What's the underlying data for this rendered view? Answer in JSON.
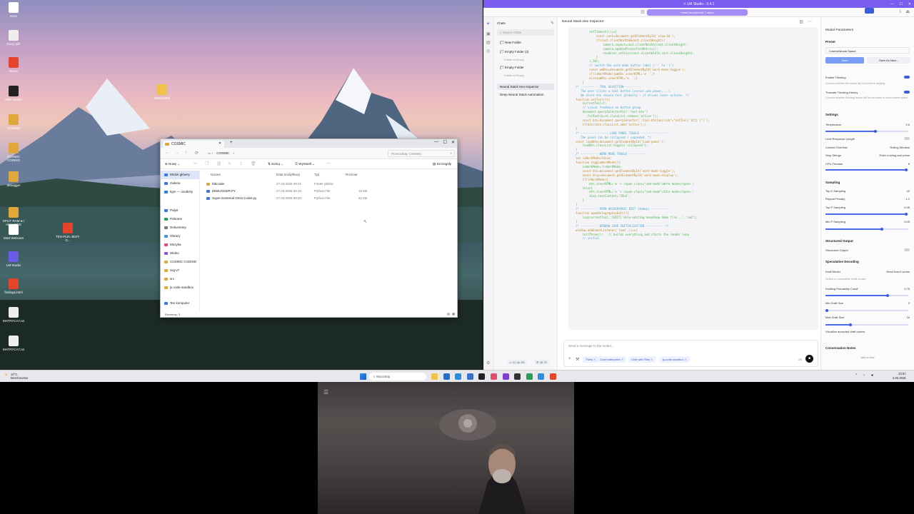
{
  "desktop": {
    "icons": [
      {
        "label": "Kosz",
        "color": "#ffffff"
      },
      {
        "label": "Nowy plik",
        "color": "#eeeeee"
      },
      {
        "label": "Brave",
        "color": "#e5432a"
      },
      {
        "label": "OBS Studio",
        "color": "#222222"
      },
      {
        "label": "COSMIC",
        "color": "#e0a83a"
      },
      {
        "label": "COSMIC CODING",
        "color": "#e0a83a"
      },
      {
        "label": "debugger",
        "color": "#e0a83a"
      },
      {
        "label": "SPLIT RAM & I AM A GOD",
        "color": "#e0a83a"
      },
      {
        "label": "Start Webcam",
        "color": "#ffffff"
      },
      {
        "label": "LM Studio",
        "color": "#6b5ce7"
      },
      {
        "label": "findings.html",
        "color": "#e5432a"
      },
      {
        "label": "MATRYCA7.txt",
        "color": "#eeeeee"
      },
      {
        "label": "MATRYCA7.txt",
        "color": "#eeeeee"
      }
    ],
    "loose_icons": [
      {
        "label": "DEBUGER",
        "color": "#f0c24a"
      },
      {
        "label": "TEN-PLIK-JEST-G...",
        "color": "#e5432a"
      }
    ]
  },
  "explorer": {
    "tab_title": "COSMIC",
    "breadcrumb": [
      "COSMIC"
    ],
    "search_placeholder": "Przeszukaj: COSMIC",
    "toolbar": {
      "new": "Nowy",
      "sort": "Sortuj",
      "view": "Wyświetl",
      "more": "···",
      "details": "Szczegóły"
    },
    "nav": [
      {
        "label": "Widok główny",
        "color": "#3b78e7"
      },
      {
        "label": "Galeria",
        "color": "#3b78e7"
      },
      {
        "label": "kgm — osobisty",
        "color": "#2b7bd8"
      },
      {
        "label": "Pulpit",
        "color": "#3b78e7"
      },
      {
        "label": "Pobrane",
        "color": "#2a9d5b"
      },
      {
        "label": "Dokumenty",
        "color": "#7a7a7a"
      },
      {
        "label": "Obrazy",
        "color": "#4a8fe0"
      },
      {
        "label": "Muzyka",
        "color": "#e24a6e"
      },
      {
        "label": "Wideo",
        "color": "#8a55d8"
      },
      {
        "label": "COSMIC CODING",
        "color": "#e0a83a"
      },
      {
        "label": "ssg-v7",
        "color": "#e0a83a"
      },
      {
        "label": "src",
        "color": "#e0a83a"
      },
      {
        "label": "js-code-sandbox",
        "color": "#e0a83a"
      },
      {
        "label": "Ten komputer",
        "color": "#3b78e7"
      }
    ],
    "columns": [
      "Nazwa",
      "Data modyfikacji",
      "Typ",
      "Rozmiar"
    ],
    "rows": [
      {
        "name": "htbcoder",
        "date": "27.03.2026 09:41",
        "type": "Folder plików",
        "size": "",
        "color": "#e0a83a"
      },
      {
        "name": "DEBUGGER.PY",
        "date": "27.03.2026 00:10",
        "type": "Python File",
        "size": "15 KB",
        "color": "#3b78e7"
      },
      {
        "name": "Super Extremal Omni Coder.py",
        "date": "27.03.2026 00:20",
        "type": "Python File",
        "size": "21 KB",
        "color": "#3b78e7"
      }
    ],
    "status": "Elementy: 3"
  },
  "lmstudio": {
    "title": "LM Studio - 0.4.1",
    "model_selector": "metal-llama/metal-7-nemo",
    "chats_label": "Chats",
    "search_chats": "Search chats",
    "new_folder": "New Folder",
    "folders": [
      {
        "name": "Empty Folder (2)",
        "empty": "Folder is Empty"
      },
      {
        "name": "Empty Folder",
        "empty": "Folder is Empty"
      }
    ],
    "chats": [
      "Neural Stack Hex Inspector",
      "Deep Neural Stack Automation"
    ],
    "active_chat": "Neural Stack Hex Inspector",
    "code_lines": [
      "        setTimeout(()=>{",
      "            const cont=document.getElementById('view-3d');",
      "            if(cont.clientWidth&&cont.clientHeight){",
      "                camera.aspect=cont.clientWidth/cont.clientHeight;",
      "                camera.updateProjectionMatrix();",
      "                renderer.setSize(cont.clientWidth,cont.clientHeight);",
      "            }",
      "        },50);",
      "",
      "        // switch the work-mode button label ('-' to '|')",
      "        const wmBtn=document.getElementById('work-mode-toggle');",
      "        if(isWorkMode){wmBtn.innerHTML='⊗  ';}",
      "        else{wmBtn.innerHTML='⊕  ';}",
      "    }",
      "",
      "/* ---------- TOOL SELECTION ---------",
      "   The user clicks a tool button (cursor,pan,power,...).",
      "   We store the chosen tool globally – it drives later actions. */",
      "function setTool(t){",
      "    currentTool=t;",
      "",
      "    // visual feedback on button group",
      "    document.querySelectorAll('.tool-btn')",
      "      .forEach(b=>b.classList.remove('active'));",
      "    const btn=document.querySelector(`.tool-btn[onclick*=\"setTool('${t}')\"]`);",
      "    if(btn){btn.classList.add('active');}",
      "}",
      "",
      "/* ---------------- LOAD PANEL TOGGLE ----------------",
      "   The panel can be collapsed / expanded. */",
      "const loadBtn=document.getElementById('load-panel');",
      "    loadBtn.classList.toggle('collapsed');",
      "}",
      "",
      "/* ---------- WORK-MODE TOGGLE -----------",
      "let isWorkMode=false;",
      "function toggleWorkMode(){",
      "    isWorkMode=!isWorkMode;",
      "",
      "    const btn=document.getElementById('work-mode-toggle');",
      "    const disp=document.getElementById('work-mode-display');",
      "",
      "    if(isWorkMode){",
      "        btn.innerHTML='⊗ '+`<span class=\"cmd-mode\">Work mode</span>`;",
      "    }else{",
      "        btn.innerHTML='⊕ '+`<span class=\"cmd-mode\">Idle mode</span>`;",
      "        disp.textContent='IDLE';",
      "    }",
      "}",
      "",
      "/* ---------- OPEN HOLOGRAPHIC EDIT (dummy) ----------",
      "function openHolographicEdit(){",
      "    log(currentTool,'[EDIT] Holo-editing hexedump demo file...','cmd');",
      "}",
      "",
      "/* ---------- WINDOW LOAD INITIALISATION ---------- */",
      "window.addEventListener('load',()=>{",
      "    initThree();   // builds everything and starts the render loop",
      "",
      "    // initial"
    ],
    "composer_placeholder": "Send a message to the model...",
    "composer_pills": [
      "Think",
      "Code interpreter",
      "Chat with Files",
      "js-code-sandbox"
    ],
    "token_count": "2/8",
    "footer_stats": [
      "21.46 GB",
      "48.75"
    ],
    "params": {
      "header": "Model Parameters",
      "preset_label": "Preset",
      "preset_value": "CosmicNeural Space",
      "save": "Save",
      "save_as": "Save As New...",
      "enable_thinking": "Enable Thinking",
      "enable_thinking_desc": "Controls whether the model will think before replying",
      "truncate_thinking": "Truncate Thinking History",
      "truncate_desc": "Controls whether thinking history will be truncated to save context space",
      "settings": "Settings",
      "temperature": "Temperature",
      "temperature_value": "0.6",
      "temperature_fraction": 0.6,
      "limit_length": "Limit Response Length",
      "context_overflow": "Context Overflow",
      "context_overflow_value": "Rolling Window",
      "stop_strings": "Stop Strings",
      "stop_placeholder": "Enter a string and press",
      "cpu_threads": "CPU Threads",
      "cpu_threads_value": "8",
      "sampling": "Sampling",
      "top_k": "Top K Sampling",
      "top_k_value": "40",
      "repeat_penalty": "Repeat Penalty",
      "repeat_penalty_value": "1.1",
      "top_p": "Top P Sampling",
      "top_p_value": "0.95",
      "min_p": "Min P Sampling",
      "min_p_value": "0.05",
      "structured_output": "Structured Output",
      "structured_output_toggle": "Structured Output",
      "spec_decoding": "Speculative Decoding",
      "draft_model": "Draft Model",
      "draft_link": "Read how it works",
      "draft_placeholder": "Select a compatible draft model",
      "drafting_prob": "Drafting Probability Cutoff",
      "drafting_prob_value": "0.75",
      "min_draft": "Min Draft Size",
      "min_draft_value": "0",
      "max_draft": "Max Draft Size",
      "max_draft_value": "16",
      "visualize": "Visualize accepted draft tokens",
      "conv_notes": "Conversation Notes",
      "add_note": "Add a note"
    }
  },
  "taskbar": {
    "weather_temp": "10°C",
    "weather_desc": "Bezchmurnie",
    "search_placeholder": "Wyszukaj",
    "time": "22:57",
    "date": "2.02.2026",
    "apps": [
      "#f0c24a",
      "#1f6fd0",
      "#2a8ee0",
      "#3a6fd0",
      "#222222",
      "#e24a6e",
      "#7a3fd0",
      "#333333",
      "#2a9d5b",
      "#2a8ee0",
      "#e5432a"
    ]
  },
  "colors": {
    "accent": "#7b5cf0",
    "link": "#3b5bdb"
  }
}
